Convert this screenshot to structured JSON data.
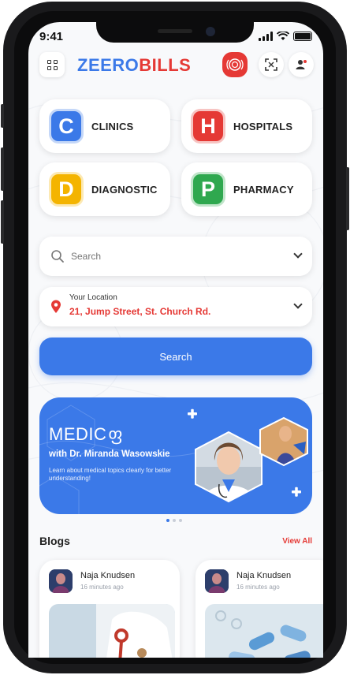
{
  "status_bar": {
    "time": "9:41"
  },
  "header": {
    "logo_part1": "ZEERO",
    "logo_part2": "BILLS",
    "menu_icon": "grid-icon",
    "sos_icon": "sos-icon",
    "scan_icon": "scan-icon",
    "profile_icon": "profile-icon"
  },
  "categories": [
    {
      "letter": "C",
      "label": "CLINICS",
      "color": "#3b79e8"
    },
    {
      "letter": "H",
      "label": "HOSPITALS",
      "color": "#e53935"
    },
    {
      "letter": "D",
      "label": "DIAGNOSTIC",
      "color": "#f4b400"
    },
    {
      "letter": "P",
      "label": "PHARMACY",
      "color": "#2fa84f"
    }
  ],
  "search": {
    "placeholder": "Search"
  },
  "location": {
    "label": "Your Location",
    "value": "21, Jump Street, St. Church Rd."
  },
  "search_button": {
    "label": "Search"
  },
  "banner": {
    "title": "MEDIC",
    "title_glyph": "ფ",
    "subtitle": "with Dr. Miranda Wasowskie",
    "text": "Learn about medical topics clearly for better understanding!"
  },
  "blogs": {
    "title": "Blogs",
    "view_all": "View All",
    "items": [
      {
        "author": "Naja Knudsen",
        "time": "16 minutes ago"
      },
      {
        "author": "Naja Knudsen",
        "time": "16 minutes ago"
      }
    ]
  },
  "colors": {
    "primary": "#3b79e8",
    "accent": "#e53935"
  }
}
